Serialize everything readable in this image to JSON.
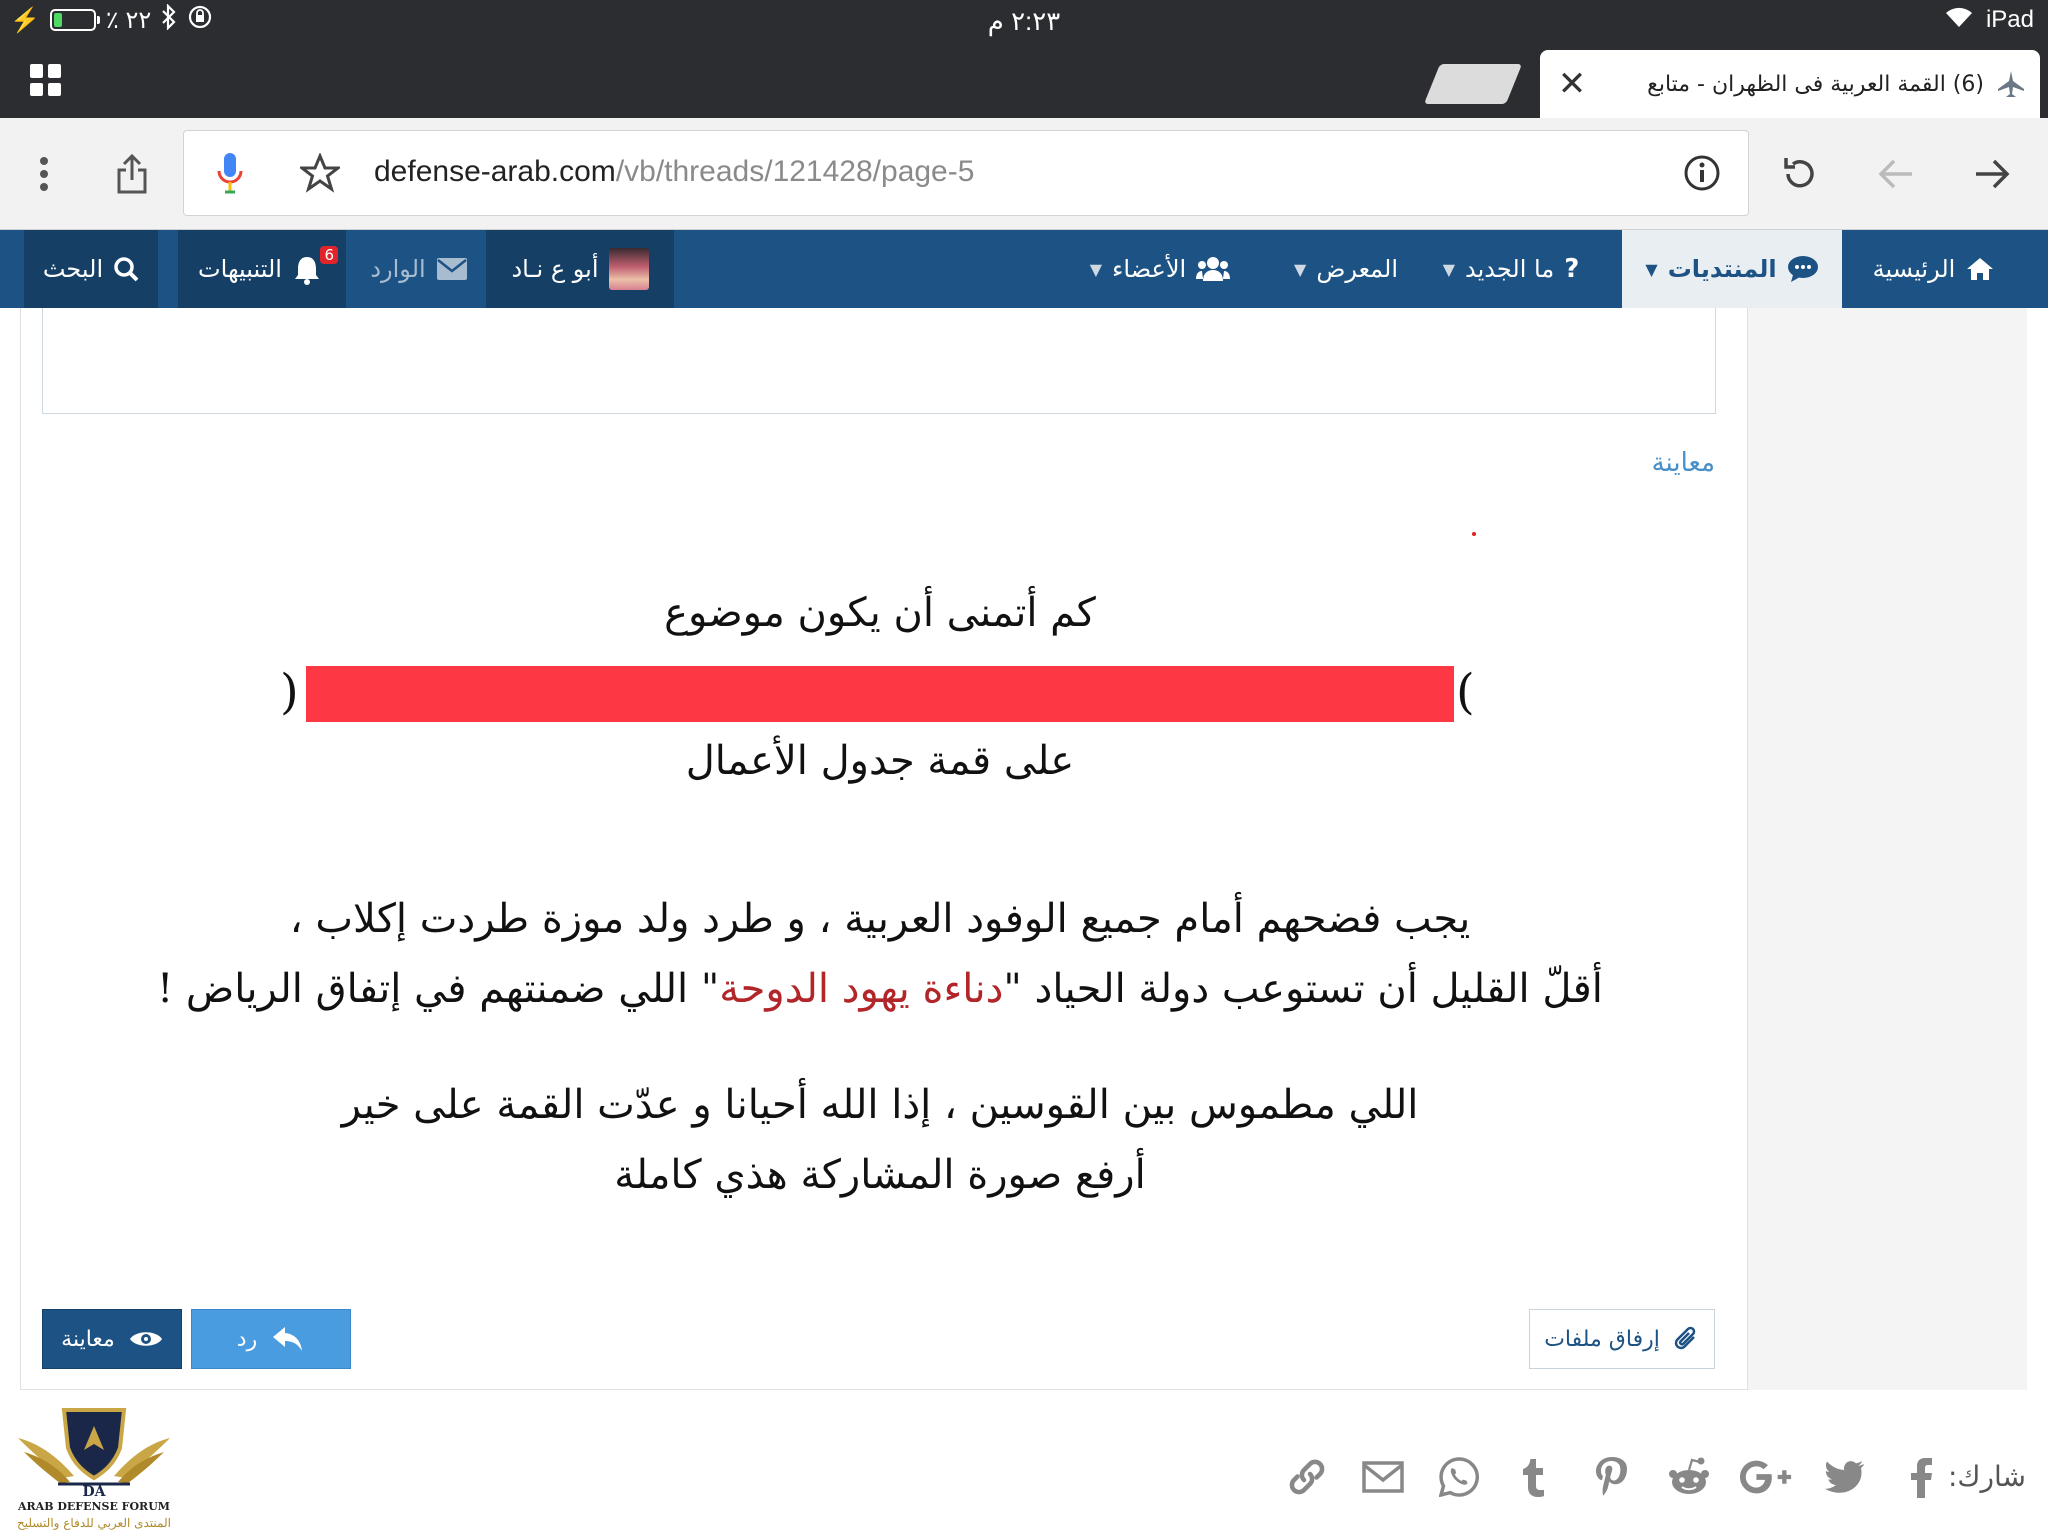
{
  "status_bar": {
    "battery_percent": "٪ ٢٢",
    "battery_level": 0.22,
    "time": "٢:٢٣ م",
    "device": "iPad"
  },
  "browser": {
    "tab_title": "(6) القمة العربية فى الظهران - متابع",
    "url_domain": "defense-arab.com",
    "url_path": "/vb/threads/121428/page-5"
  },
  "nav": {
    "home": "الرئيسية",
    "forums": "المنتديات",
    "whats_new": "ما الجديد",
    "gallery": "المعرض",
    "members": "الأعضاء",
    "username": "أبو ع نـاد",
    "inbox": "الوارد",
    "alerts": "التنبيهات",
    "alerts_count": "6",
    "search": "البحث"
  },
  "editor": {
    "preview_label": "معاينة"
  },
  "post": {
    "line1": "كم أتمنى أن يكون موضوع",
    "paren_open": "(",
    "paren_close": ")",
    "line3": "على قمة جدول الأعمال",
    "line4": "يجب فضحهم أمام جميع الوفود العربية ، و طرد ولد موزة طردت إكلاب ،",
    "line5_a": "أقلّ القليل أن تستوعب دولة الحياد \"",
    "line5_highlight": "دناءة يهود الدوحة",
    "line5_b": "\" اللي ضمنتهم في إتفاق الرياض !",
    "line6": "اللي مطموس بين القوسين ، إذا الله أحيانا و عدّت القمة على خير",
    "line7": "أرفع صورة المشاركة هذي كاملة"
  },
  "buttons": {
    "preview": "معاينة",
    "reply": "رد",
    "attach": "إرفاق ملفات"
  },
  "share": {
    "label": "شارك:"
  },
  "logo": {
    "initials": "DA",
    "name_en": "ARAB DEFENSE FORUM",
    "name_ar": "المنتدى العربي للدفاع والتسليح"
  },
  "colors": {
    "nav_blue": "#1d5284",
    "redaction": "#fe3745",
    "link_blue": "#4a90c8",
    "highlight_red": "#b2262a"
  }
}
